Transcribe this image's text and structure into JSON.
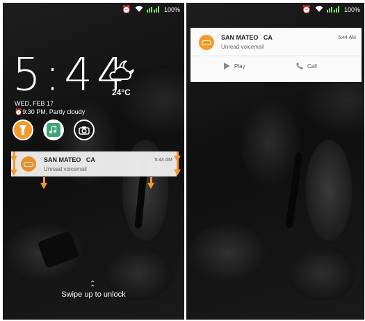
{
  "status_bar": {
    "battery_text": "100%"
  },
  "lock_screen": {
    "time": "5:44",
    "temperature": "24°C",
    "date": "WED, FEB 17",
    "alarm_weather": "9:30 PM, Partly cloudy",
    "unlock_hint": "Swipe up to unlock"
  },
  "notification": {
    "title": "SAN MATEO   CA",
    "subtitle": "Unread voicemail",
    "time": "5:44 AM",
    "actions": [
      {
        "label": "Play"
      },
      {
        "label": "Call"
      }
    ]
  },
  "colors": {
    "accent": "#f39a2b",
    "signal": "#7be36b",
    "card": "#fafafa"
  },
  "icons": [
    "alarm-icon",
    "wifi-icon",
    "signal-icon",
    "battery-icon",
    "weather-icon",
    "flashlight-icon",
    "music-icon",
    "camera-icon",
    "voicemail-icon",
    "play-icon",
    "phone-icon"
  ]
}
